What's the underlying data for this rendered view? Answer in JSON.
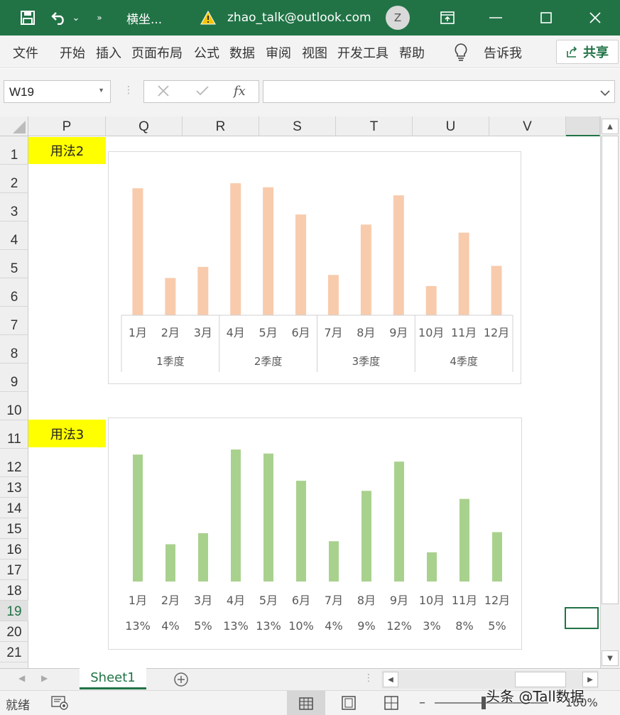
{
  "titlebar": {
    "filename": "横坐...",
    "account": "zhao_talk@outlook.com",
    "avatar_initial": "Z"
  },
  "ribbon": {
    "tabs": [
      "文件",
      "开始",
      "插入",
      "页面布局",
      "公式",
      "数据",
      "审阅",
      "视图",
      "开发工具",
      "帮助"
    ],
    "tell_me": "告诉我",
    "share": "共享"
  },
  "formula_bar": {
    "name_box": "W19",
    "fx": "fx",
    "formula": ""
  },
  "columns": [
    "P",
    "Q",
    "R",
    "S",
    "T",
    "U",
    "V"
  ],
  "rows": [
    "1",
    "2",
    "3",
    "4",
    "5",
    "6",
    "7",
    "8",
    "9",
    "10",
    "11",
    "12",
    "13",
    "14",
    "15",
    "16",
    "17",
    "18",
    "19",
    "20",
    "21"
  ],
  "selected_row": "19",
  "cells": {
    "P1": "用法2",
    "P11": "用法3"
  },
  "chart_data": [
    {
      "type": "bar",
      "categories": [
        "1月",
        "2月",
        "3月",
        "4月",
        "5月",
        "6月",
        "7月",
        "8月",
        "9月",
        "10月",
        "11月",
        "12月"
      ],
      "groups": [
        {
          "label": "1季度",
          "members": [
            "1月",
            "2月",
            "3月"
          ]
        },
        {
          "label": "2季度",
          "members": [
            "4月",
            "5月",
            "6月"
          ]
        },
        {
          "label": "3季度",
          "members": [
            "7月",
            "8月",
            "9月"
          ]
        },
        {
          "label": "4季度",
          "members": [
            "10月",
            "11月",
            "12月"
          ]
        }
      ],
      "values": [
        12.6,
        3.7,
        4.8,
        13.1,
        12.7,
        10.0,
        4.0,
        9.0,
        11.9,
        2.9,
        8.2,
        4.9
      ],
      "ylim": [
        0,
        13.6
      ],
      "color": "#f8cbad",
      "grid": false,
      "title": "",
      "xlabel": "",
      "ylabel": ""
    },
    {
      "type": "bar",
      "categories": [
        "1月",
        "2月",
        "3月",
        "4月",
        "5月",
        "6月",
        "7月",
        "8月",
        "9月",
        "10月",
        "11月",
        "12月"
      ],
      "data_labels": [
        "13%",
        "4%",
        "5%",
        "13%",
        "13%",
        "10%",
        "4%",
        "9%",
        "12%",
        "3%",
        "8%",
        "5%"
      ],
      "values": [
        12.6,
        3.7,
        4.8,
        13.1,
        12.7,
        10.0,
        4.0,
        9.0,
        11.9,
        2.9,
        8.2,
        4.9
      ],
      "ylim": [
        0,
        13.6
      ],
      "color": "#a9d18e",
      "grid": false,
      "title": "",
      "xlabel": "",
      "ylabel": ""
    }
  ],
  "sheet_tabs": [
    "Sheet1"
  ],
  "status": {
    "ready": "就绪",
    "zoom": "100%"
  },
  "watermark": "头条 @Tall数据",
  "colors": {
    "excel_green": "#217346",
    "highlight": "#ffff00"
  },
  "icons": [
    "save-icon",
    "undo-icon",
    "warning-icon",
    "restore-icon",
    "lightbulb-icon",
    "share-icon",
    "add-sheet-icon"
  ]
}
